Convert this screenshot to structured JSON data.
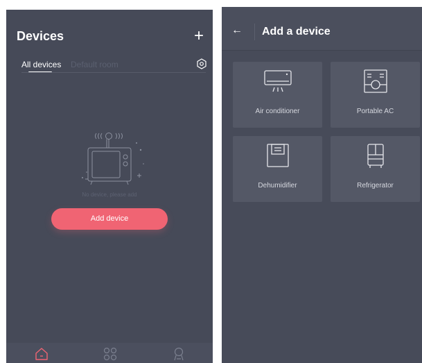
{
  "devices_screen": {
    "title": "Devices",
    "add_icon_glyph": "+",
    "tabs": [
      {
        "label": "All devices",
        "active": true
      },
      {
        "label": "Default room",
        "active": false
      }
    ],
    "empty_message": "No device, please add",
    "add_button_label": "Add device",
    "bottom_nav": [
      {
        "icon": "home-icon",
        "active": true
      },
      {
        "icon": "grid-icon",
        "active": false
      },
      {
        "icon": "profile-icon",
        "active": false
      }
    ]
  },
  "add_device_screen": {
    "back_glyph": "←",
    "title": "Add a device",
    "device_types": [
      {
        "label": "Air conditioner",
        "icon": "air-conditioner-icon"
      },
      {
        "label": "Portable AC",
        "icon": "portable-ac-icon"
      },
      {
        "label": "Dehumidifier",
        "icon": "dehumidifier-icon"
      },
      {
        "label": "Refrigerator",
        "icon": "refrigerator-icon"
      }
    ]
  },
  "colors": {
    "background": "#464a58",
    "accent": "#f06473",
    "text_primary": "#ffffff",
    "text_muted": "#5d6272"
  }
}
